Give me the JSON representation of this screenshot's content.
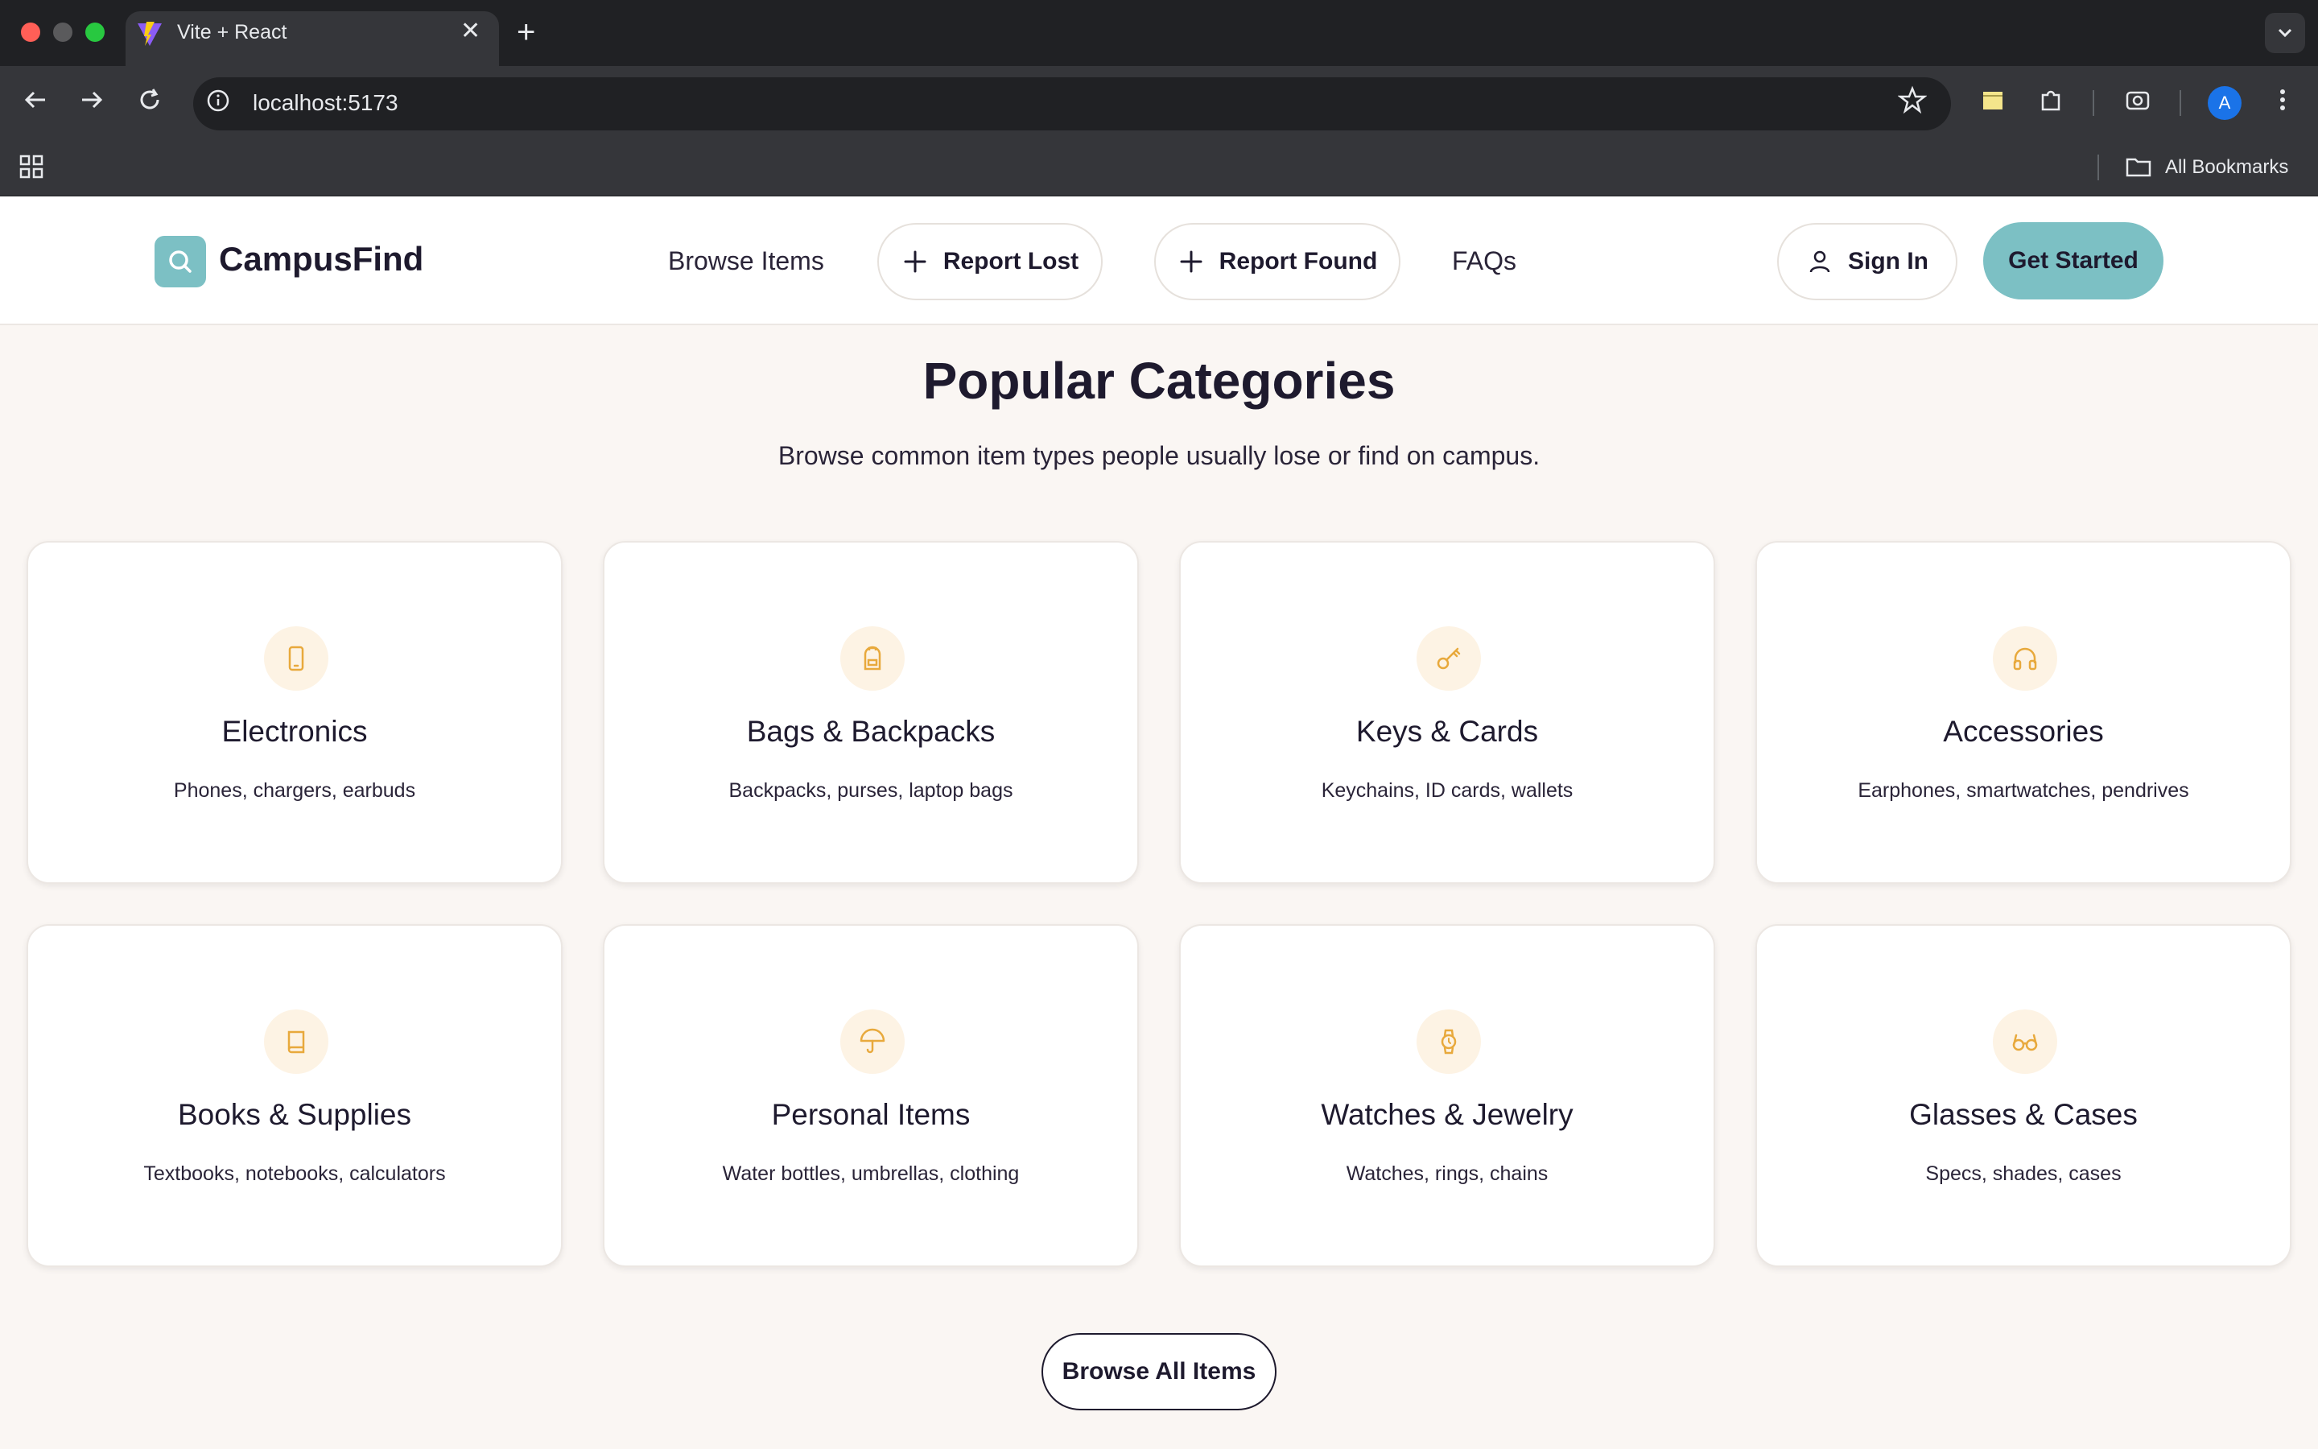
{
  "browser": {
    "tab_title": "Vite + React",
    "url": "localhost:5173",
    "bookmarks_label": "All Bookmarks",
    "profile_initial": "A"
  },
  "header": {
    "logo_text": "CampusFind",
    "nav": {
      "browse_items": "Browse Items",
      "report_lost": "Report Lost",
      "report_found": "Report Found",
      "faqs": "FAQs"
    },
    "sign_in": "Sign In",
    "get_started": "Get Started"
  },
  "main": {
    "title": "Popular Categories",
    "subtitle": "Browse common item types people usually lose or find on campus.",
    "categories": [
      {
        "title": "Electronics",
        "desc": "Phones, chargers, earbuds",
        "icon": "smartphone-icon"
      },
      {
        "title": "Bags & Backpacks",
        "desc": "Backpacks, purses, laptop bags",
        "icon": "backpack-icon"
      },
      {
        "title": "Keys & Cards",
        "desc": "Keychains, ID cards, wallets",
        "icon": "key-icon"
      },
      {
        "title": "Accessories",
        "desc": "Earphones, smartwatches, pendrives",
        "icon": "headphones-icon"
      },
      {
        "title": "Books & Supplies",
        "desc": "Textbooks, notebooks, calculators",
        "icon": "book-icon"
      },
      {
        "title": "Personal Items",
        "desc": "Water bottles, umbrellas, clothing",
        "icon": "umbrella-icon"
      },
      {
        "title": "Watches & Jewelry",
        "desc": "Watches, rings, chains",
        "icon": "watch-icon"
      },
      {
        "title": "Glasses & Cases",
        "desc": "Specs, shades, cases",
        "icon": "glasses-icon"
      }
    ],
    "browse_all": "Browse All Items"
  },
  "colors": {
    "accent": "#7cc0c4",
    "icon": "#e8a93c",
    "icon_bg": "#fdf3e4",
    "text": "#1e1a2e",
    "page_bg": "#faf6f3"
  }
}
